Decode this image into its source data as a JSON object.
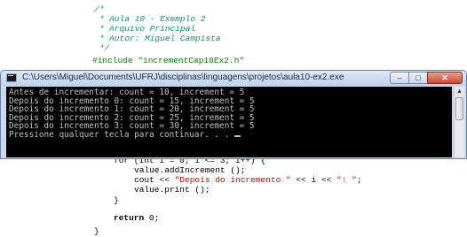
{
  "editor": {
    "comment_open": "/*",
    "comment_lines": [
      " * Aula 10 - Exemplo 2",
      " * Arquivo Principal",
      " * Autor: Miguel Campista",
      " */"
    ],
    "include_line": "#include \"incrementCap10Ex2.h\"",
    "for_line": "for (int i = 0; i <= 3; i++) {",
    "call_increment": "value.addIncrement ();",
    "cout_prefix": "cout << ",
    "cout_string": "\"Depois do incremento \"",
    "cout_middle": " << i << ",
    "cout_string2": "\": \"",
    "cout_end": ";",
    "call_print": "value.print ();",
    "close_brace_inner": "}",
    "return_kw": "return",
    "return_val": " 0;",
    "close_brace_outer": "}"
  },
  "console_window": {
    "title": "C:\\Users\\Miguel\\Documents\\UFRJ\\disciplinas\\linguagens\\projetos\\aula10-ex2.exe",
    "controls": {
      "minimize": "–",
      "maximize": "□",
      "close": "✕"
    },
    "icon": "console-app-icon",
    "lines": [
      "Antes de incrementar: count = 10, increment = 5",
      "Depois do incremento 0: count = 15, increment = 5",
      "Depois do incremento 1: count = 20, increment = 5",
      "Depois do incremento 2: count = 25, increment = 5",
      "Depois do incremento 3: count = 30, increment = 5",
      "Pressione qualquer tecla para continuar. . . "
    ],
    "scroll_up": "▲"
  }
}
